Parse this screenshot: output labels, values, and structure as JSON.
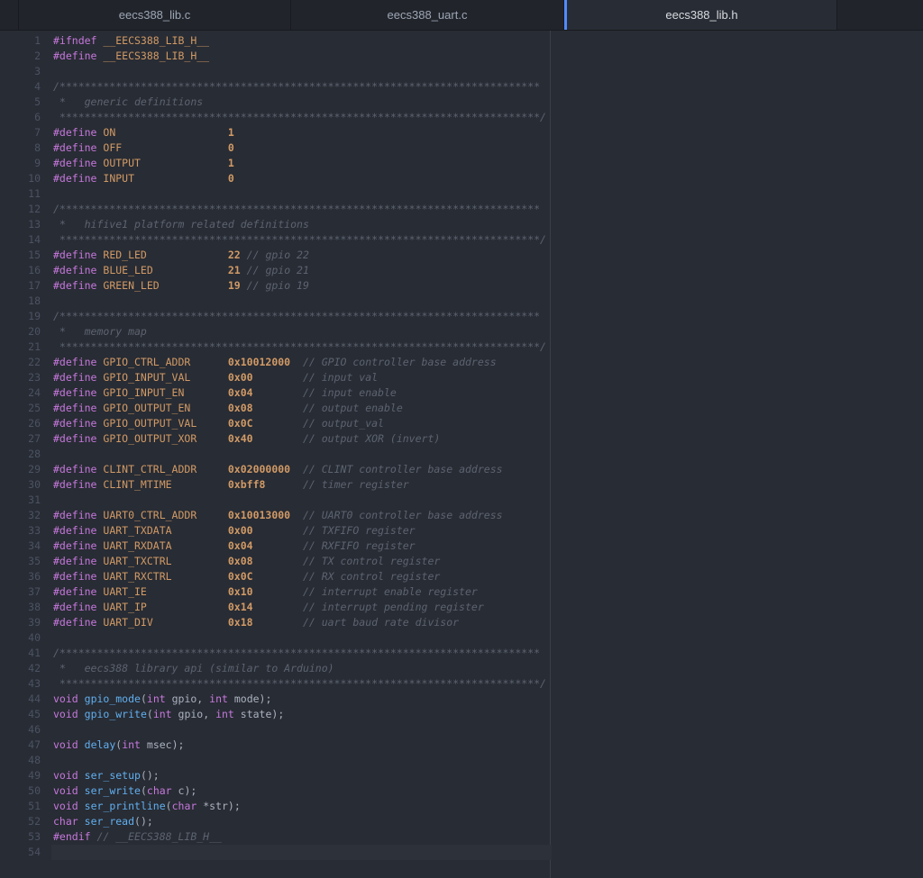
{
  "colors": {
    "bg": "#282c34",
    "panel": "#21252b",
    "border": "#181a1f",
    "accent": "#528bff",
    "text": "#abb2bf",
    "text-dim": "#4b5263",
    "tab-inactive-text": "#9da5b4",
    "tab-active-text": "#d7dae0",
    "keyword": "#c678dd",
    "constant": "#d19a66",
    "function": "#61afef",
    "comment": "#5c6370",
    "line-highlight": "#2c313a"
  },
  "tabs": [
    {
      "label": "eecs388_lib.c",
      "active": false
    },
    {
      "label": "eecs388_uart.c",
      "active": false
    },
    {
      "label": "eecs388_lib.h",
      "active": true
    }
  ],
  "code": {
    "current_line": 54,
    "lines": [
      {
        "n": 1,
        "seg": [
          [
            "kw",
            "#ifndef "
          ],
          [
            "name",
            "__EECS388_LIB_H__"
          ]
        ]
      },
      {
        "n": 2,
        "seg": [
          [
            "kw",
            "#define "
          ],
          [
            "name",
            "__EECS388_LIB_H__"
          ]
        ]
      },
      {
        "n": 3,
        "seg": []
      },
      {
        "n": 4,
        "seg": [
          [
            "cm",
            "/*****************************************************************************"
          ]
        ]
      },
      {
        "n": 5,
        "seg": [
          [
            "cm",
            " *   generic definitions"
          ]
        ]
      },
      {
        "n": 6,
        "seg": [
          [
            "cm",
            " *****************************************************************************/"
          ]
        ]
      },
      {
        "n": 7,
        "seg": [
          [
            "kw",
            "#define "
          ],
          [
            "name",
            "ON"
          ],
          [
            "tx",
            "                  "
          ],
          [
            "num",
            "1"
          ]
        ]
      },
      {
        "n": 8,
        "seg": [
          [
            "kw",
            "#define "
          ],
          [
            "name",
            "OFF"
          ],
          [
            "tx",
            "                 "
          ],
          [
            "num",
            "0"
          ]
        ]
      },
      {
        "n": 9,
        "seg": [
          [
            "kw",
            "#define "
          ],
          [
            "name",
            "OUTPUT"
          ],
          [
            "tx",
            "              "
          ],
          [
            "num",
            "1"
          ]
        ]
      },
      {
        "n": 10,
        "seg": [
          [
            "kw",
            "#define "
          ],
          [
            "name",
            "INPUT"
          ],
          [
            "tx",
            "               "
          ],
          [
            "num",
            "0"
          ]
        ]
      },
      {
        "n": 11,
        "seg": []
      },
      {
        "n": 12,
        "seg": [
          [
            "cm",
            "/*****************************************************************************"
          ]
        ]
      },
      {
        "n": 13,
        "seg": [
          [
            "cm",
            " *   hifive1 platform related definitions"
          ]
        ]
      },
      {
        "n": 14,
        "seg": [
          [
            "cm",
            " *****************************************************************************/"
          ]
        ]
      },
      {
        "n": 15,
        "seg": [
          [
            "kw",
            "#define "
          ],
          [
            "name",
            "RED_LED"
          ],
          [
            "tx",
            "             "
          ],
          [
            "num",
            "22"
          ],
          [
            "tx",
            " "
          ],
          [
            "cm",
            "// gpio 22"
          ]
        ]
      },
      {
        "n": 16,
        "seg": [
          [
            "kw",
            "#define "
          ],
          [
            "name",
            "BLUE_LED"
          ],
          [
            "tx",
            "            "
          ],
          [
            "num",
            "21"
          ],
          [
            "tx",
            " "
          ],
          [
            "cm",
            "// gpio 21"
          ]
        ]
      },
      {
        "n": 17,
        "seg": [
          [
            "kw",
            "#define "
          ],
          [
            "name",
            "GREEN_LED"
          ],
          [
            "tx",
            "           "
          ],
          [
            "num",
            "19"
          ],
          [
            "tx",
            " "
          ],
          [
            "cm",
            "// gpio 19"
          ]
        ]
      },
      {
        "n": 18,
        "seg": []
      },
      {
        "n": 19,
        "seg": [
          [
            "cm",
            "/*****************************************************************************"
          ]
        ]
      },
      {
        "n": 20,
        "seg": [
          [
            "cm",
            " *   memory map"
          ]
        ]
      },
      {
        "n": 21,
        "seg": [
          [
            "cm",
            " *****************************************************************************/"
          ]
        ]
      },
      {
        "n": 22,
        "seg": [
          [
            "kw",
            "#define "
          ],
          [
            "name",
            "GPIO_CTRL_ADDR"
          ],
          [
            "tx",
            "      "
          ],
          [
            "num",
            "0x10012000"
          ],
          [
            "tx",
            "  "
          ],
          [
            "cm",
            "// GPIO controller base address"
          ]
        ]
      },
      {
        "n": 23,
        "seg": [
          [
            "kw",
            "#define "
          ],
          [
            "name",
            "GPIO_INPUT_VAL"
          ],
          [
            "tx",
            "      "
          ],
          [
            "num",
            "0x00"
          ],
          [
            "tx",
            "        "
          ],
          [
            "cm",
            "// input val"
          ]
        ]
      },
      {
        "n": 24,
        "seg": [
          [
            "kw",
            "#define "
          ],
          [
            "name",
            "GPIO_INPUT_EN"
          ],
          [
            "tx",
            "       "
          ],
          [
            "num",
            "0x04"
          ],
          [
            "tx",
            "        "
          ],
          [
            "cm",
            "// input enable"
          ]
        ]
      },
      {
        "n": 25,
        "seg": [
          [
            "kw",
            "#define "
          ],
          [
            "name",
            "GPIO_OUTPUT_EN"
          ],
          [
            "tx",
            "      "
          ],
          [
            "num",
            "0x08"
          ],
          [
            "tx",
            "        "
          ],
          [
            "cm",
            "// output enable"
          ]
        ]
      },
      {
        "n": 26,
        "seg": [
          [
            "kw",
            "#define "
          ],
          [
            "name",
            "GPIO_OUTPUT_VAL"
          ],
          [
            "tx",
            "     "
          ],
          [
            "num",
            "0x0C"
          ],
          [
            "tx",
            "        "
          ],
          [
            "cm",
            "// output_val"
          ]
        ]
      },
      {
        "n": 27,
        "seg": [
          [
            "kw",
            "#define "
          ],
          [
            "name",
            "GPIO_OUTPUT_XOR"
          ],
          [
            "tx",
            "     "
          ],
          [
            "num",
            "0x40"
          ],
          [
            "tx",
            "        "
          ],
          [
            "cm",
            "// output XOR (invert)"
          ]
        ]
      },
      {
        "n": 28,
        "seg": []
      },
      {
        "n": 29,
        "seg": [
          [
            "kw",
            "#define "
          ],
          [
            "name",
            "CLINT_CTRL_ADDR"
          ],
          [
            "tx",
            "     "
          ],
          [
            "num",
            "0x02000000"
          ],
          [
            "tx",
            "  "
          ],
          [
            "cm",
            "// CLINT controller base address"
          ]
        ]
      },
      {
        "n": 30,
        "seg": [
          [
            "kw",
            "#define "
          ],
          [
            "name",
            "CLINT_MTIME"
          ],
          [
            "tx",
            "         "
          ],
          [
            "num",
            "0xbff8"
          ],
          [
            "tx",
            "      "
          ],
          [
            "cm",
            "// timer register"
          ]
        ]
      },
      {
        "n": 31,
        "seg": []
      },
      {
        "n": 32,
        "seg": [
          [
            "kw",
            "#define "
          ],
          [
            "name",
            "UART0_CTRL_ADDR"
          ],
          [
            "tx",
            "     "
          ],
          [
            "num",
            "0x10013000"
          ],
          [
            "tx",
            "  "
          ],
          [
            "cm",
            "// UART0 controller base address"
          ]
        ]
      },
      {
        "n": 33,
        "seg": [
          [
            "kw",
            "#define "
          ],
          [
            "name",
            "UART_TXDATA"
          ],
          [
            "tx",
            "         "
          ],
          [
            "num",
            "0x00"
          ],
          [
            "tx",
            "        "
          ],
          [
            "cm",
            "// TXFIFO register"
          ]
        ]
      },
      {
        "n": 34,
        "seg": [
          [
            "kw",
            "#define "
          ],
          [
            "name",
            "UART_RXDATA"
          ],
          [
            "tx",
            "         "
          ],
          [
            "num",
            "0x04"
          ],
          [
            "tx",
            "        "
          ],
          [
            "cm",
            "// RXFIFO register"
          ]
        ]
      },
      {
        "n": 35,
        "seg": [
          [
            "kw",
            "#define "
          ],
          [
            "name",
            "UART_TXCTRL"
          ],
          [
            "tx",
            "         "
          ],
          [
            "num",
            "0x08"
          ],
          [
            "tx",
            "        "
          ],
          [
            "cm",
            "// TX control register"
          ]
        ]
      },
      {
        "n": 36,
        "seg": [
          [
            "kw",
            "#define "
          ],
          [
            "name",
            "UART_RXCTRL"
          ],
          [
            "tx",
            "         "
          ],
          [
            "num",
            "0x0C"
          ],
          [
            "tx",
            "        "
          ],
          [
            "cm",
            "// RX control register"
          ]
        ]
      },
      {
        "n": 37,
        "seg": [
          [
            "kw",
            "#define "
          ],
          [
            "name",
            "UART_IE"
          ],
          [
            "tx",
            "             "
          ],
          [
            "num",
            "0x10"
          ],
          [
            "tx",
            "        "
          ],
          [
            "cm",
            "// interrupt enable register"
          ]
        ]
      },
      {
        "n": 38,
        "seg": [
          [
            "kw",
            "#define "
          ],
          [
            "name",
            "UART_IP"
          ],
          [
            "tx",
            "             "
          ],
          [
            "num",
            "0x14"
          ],
          [
            "tx",
            "        "
          ],
          [
            "cm",
            "// interrupt pending register"
          ]
        ]
      },
      {
        "n": 39,
        "seg": [
          [
            "kw",
            "#define "
          ],
          [
            "name",
            "UART_DIV"
          ],
          [
            "tx",
            "            "
          ],
          [
            "num",
            "0x18"
          ],
          [
            "tx",
            "        "
          ],
          [
            "cm",
            "// uart baud rate divisor"
          ]
        ]
      },
      {
        "n": 40,
        "seg": []
      },
      {
        "n": 41,
        "seg": [
          [
            "cm",
            "/*****************************************************************************"
          ]
        ]
      },
      {
        "n": 42,
        "seg": [
          [
            "cm",
            " *   eecs388 library api (similar to Arduino)"
          ]
        ]
      },
      {
        "n": 43,
        "seg": [
          [
            "cm",
            " *****************************************************************************/"
          ]
        ]
      },
      {
        "n": 44,
        "seg": [
          [
            "kw",
            "void"
          ],
          [
            "tx",
            " "
          ],
          [
            "fn",
            "gpio_mode"
          ],
          [
            "tx",
            "("
          ],
          [
            "kw",
            "int"
          ],
          [
            "tx",
            " gpio, "
          ],
          [
            "kw",
            "int"
          ],
          [
            "tx",
            " mode);"
          ]
        ]
      },
      {
        "n": 45,
        "seg": [
          [
            "kw",
            "void"
          ],
          [
            "tx",
            " "
          ],
          [
            "fn",
            "gpio_write"
          ],
          [
            "tx",
            "("
          ],
          [
            "kw",
            "int"
          ],
          [
            "tx",
            " gpio, "
          ],
          [
            "kw",
            "int"
          ],
          [
            "tx",
            " state);"
          ]
        ]
      },
      {
        "n": 46,
        "seg": []
      },
      {
        "n": 47,
        "seg": [
          [
            "kw",
            "void"
          ],
          [
            "tx",
            " "
          ],
          [
            "fn",
            "delay"
          ],
          [
            "tx",
            "("
          ],
          [
            "kw",
            "int"
          ],
          [
            "tx",
            " msec);"
          ]
        ]
      },
      {
        "n": 48,
        "seg": []
      },
      {
        "n": 49,
        "seg": [
          [
            "kw",
            "void"
          ],
          [
            "tx",
            " "
          ],
          [
            "fn",
            "ser_setup"
          ],
          [
            "tx",
            "();"
          ]
        ]
      },
      {
        "n": 50,
        "seg": [
          [
            "kw",
            "void"
          ],
          [
            "tx",
            " "
          ],
          [
            "fn",
            "ser_write"
          ],
          [
            "tx",
            "("
          ],
          [
            "kw",
            "char"
          ],
          [
            "tx",
            " c);"
          ]
        ]
      },
      {
        "n": 51,
        "seg": [
          [
            "kw",
            "void"
          ],
          [
            "tx",
            " "
          ],
          [
            "fn",
            "ser_printline"
          ],
          [
            "tx",
            "("
          ],
          [
            "kw",
            "char"
          ],
          [
            "tx",
            " *str);"
          ]
        ]
      },
      {
        "n": 52,
        "seg": [
          [
            "kw",
            "char"
          ],
          [
            "tx",
            " "
          ],
          [
            "fn",
            "ser_read"
          ],
          [
            "tx",
            "();"
          ]
        ]
      },
      {
        "n": 53,
        "seg": [
          [
            "kw",
            "#endif"
          ],
          [
            "tx",
            " "
          ],
          [
            "cm",
            "// __EECS388_LIB_H__"
          ]
        ]
      },
      {
        "n": 54,
        "seg": []
      }
    ]
  }
}
